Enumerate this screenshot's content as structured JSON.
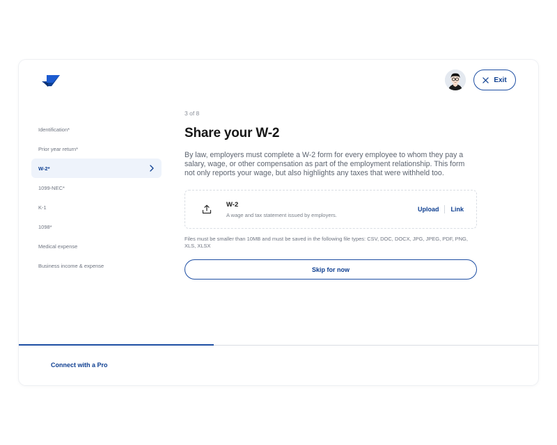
{
  "header": {
    "exit_label": "Exit"
  },
  "sidebar": {
    "items": [
      {
        "label": "Identification*"
      },
      {
        "label": "Prior year return*"
      },
      {
        "label": "W-2*"
      },
      {
        "label": "1099-NEC*"
      },
      {
        "label": "K-1"
      },
      {
        "label": "1098*"
      },
      {
        "label": "Medical expense"
      },
      {
        "label": "Business income & expense"
      }
    ],
    "active_index": 2
  },
  "main": {
    "step": "3 of 8",
    "title": "Share your W-2",
    "description": "By law, employers must complete a W-2 form for every employee to whom they pay a salary, wage, or other compensation as part of the employment relationship. This form not only reports your wage, but also highlights any taxes that were withheld too.",
    "document": {
      "name": "W-2",
      "subtitle": "A wage and tax statement issued by employers.",
      "upload_label": "Upload",
      "link_label": "Link"
    },
    "note": "Files must be smaller than 10MB and must be saved in the following file types: CSV, DOC, DOCX, JPG, JPEG, PDF, PNG, XLS, XLSX",
    "skip_label": "Skip for now"
  },
  "footer": {
    "connect_label": "Connect with a Pro",
    "progress_fraction": 0.375
  },
  "colors": {
    "brand": "#0e3f91",
    "accent": "#1d4ea3",
    "active_bg": "#eef3fb"
  },
  "icons": {
    "logo": "brand-logo-icon",
    "close": "close-icon",
    "chevron": "chevron-right-icon",
    "upload": "upload-icon"
  }
}
